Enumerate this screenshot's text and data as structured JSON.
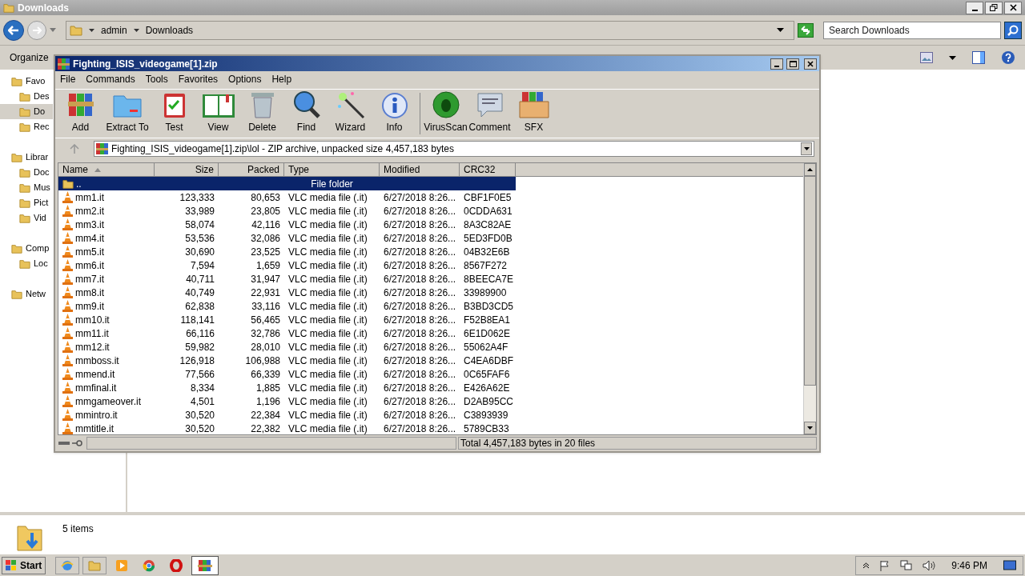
{
  "explorer": {
    "title": "Downloads",
    "breadcrumb": [
      "admin",
      "Downloads"
    ],
    "search": {
      "placeholder": "Search Downloads"
    },
    "toolbar": {
      "organize": "Organize"
    },
    "nav": [
      {
        "label": "Favo",
        "selected": false,
        "children": [
          {
            "label": "Des",
            "selected": false
          },
          {
            "label": "Do",
            "selected": true
          },
          {
            "label": "Rec",
            "selected": false
          }
        ]
      },
      {
        "label": "Librar",
        "selected": false,
        "children": [
          {
            "label": "Doc",
            "selected": false
          },
          {
            "label": "Mus",
            "selected": false
          },
          {
            "label": "Pict",
            "selected": false
          },
          {
            "label": "Vid",
            "selected": false
          }
        ]
      },
      {
        "label": "Comp",
        "selected": false,
        "children": [
          {
            "label": "Loc",
            "selected": false
          }
        ]
      },
      {
        "label": "Netw",
        "selected": false
      }
    ],
    "details": "5 items"
  },
  "winrar": {
    "title": "Fighting_ISIS_videogame[1].zip",
    "menu": [
      "File",
      "Commands",
      "Tools",
      "Favorites",
      "Options",
      "Help"
    ],
    "tools": [
      {
        "label": "Add"
      },
      {
        "label": "Extract To"
      },
      {
        "label": "Test"
      },
      {
        "label": "View"
      },
      {
        "label": "Delete"
      },
      {
        "label": "Find"
      },
      {
        "label": "Wizard"
      },
      {
        "label": "Info"
      },
      {
        "label": "VirusScan"
      },
      {
        "label": "Comment"
      },
      {
        "label": "SFX"
      }
    ],
    "address": "Fighting_ISIS_videogame[1].zip\\lol - ZIP archive, unpacked size 4,457,183 bytes",
    "columns": [
      {
        "label": "Name",
        "sorted": true
      },
      {
        "label": "Size",
        "sorted": false
      },
      {
        "label": "Packed",
        "sorted": false
      },
      {
        "label": "Type",
        "sorted": false
      },
      {
        "label": "Modified",
        "sorted": false
      },
      {
        "label": "CRC32",
        "sorted": false
      }
    ],
    "rows": [
      {
        "kind": "folder",
        "selected": true,
        "name": "..",
        "size": "",
        "packed": "",
        "type": "File folder",
        "modified": "",
        "crc": ""
      },
      {
        "kind": "file",
        "selected": false,
        "name": "mm1.it",
        "size": "123,333",
        "packed": "80,653",
        "type": "VLC media file (.it)",
        "modified": "6/27/2018 8:26...",
        "crc": "CBF1F0E5"
      },
      {
        "kind": "file",
        "selected": false,
        "name": "mm2.it",
        "size": "33,989",
        "packed": "23,805",
        "type": "VLC media file (.it)",
        "modified": "6/27/2018 8:26...",
        "crc": "0CDDA631"
      },
      {
        "kind": "file",
        "selected": false,
        "name": "mm3.it",
        "size": "58,074",
        "packed": "42,116",
        "type": "VLC media file (.it)",
        "modified": "6/27/2018 8:26...",
        "crc": "8A3C82AE"
      },
      {
        "kind": "file",
        "selected": false,
        "name": "mm4.it",
        "size": "53,536",
        "packed": "32,086",
        "type": "VLC media file (.it)",
        "modified": "6/27/2018 8:26...",
        "crc": "5ED3FD0B"
      },
      {
        "kind": "file",
        "selected": false,
        "name": "mm5.it",
        "size": "30,690",
        "packed": "23,525",
        "type": "VLC media file (.it)",
        "modified": "6/27/2018 8:26...",
        "crc": "04B32E6B"
      },
      {
        "kind": "file",
        "selected": false,
        "name": "mm6.it",
        "size": "7,594",
        "packed": "1,659",
        "type": "VLC media file (.it)",
        "modified": "6/27/2018 8:26...",
        "crc": "8567F272"
      },
      {
        "kind": "file",
        "selected": false,
        "name": "mm7.it",
        "size": "40,711",
        "packed": "31,947",
        "type": "VLC media file (.it)",
        "modified": "6/27/2018 8:26...",
        "crc": "8BEECA7E"
      },
      {
        "kind": "file",
        "selected": false,
        "name": "mm8.it",
        "size": "40,749",
        "packed": "22,931",
        "type": "VLC media file (.it)",
        "modified": "6/27/2018 8:26...",
        "crc": "33989900"
      },
      {
        "kind": "file",
        "selected": false,
        "name": "mm9.it",
        "size": "62,838",
        "packed": "33,116",
        "type": "VLC media file (.it)",
        "modified": "6/27/2018 8:26...",
        "crc": "B3BD3CD5"
      },
      {
        "kind": "file",
        "selected": false,
        "name": "mm10.it",
        "size": "118,141",
        "packed": "56,465",
        "type": "VLC media file (.it)",
        "modified": "6/27/2018 8:26...",
        "crc": "F52B8EA1"
      },
      {
        "kind": "file",
        "selected": false,
        "name": "mm11.it",
        "size": "66,116",
        "packed": "32,786",
        "type": "VLC media file (.it)",
        "modified": "6/27/2018 8:26...",
        "crc": "6E1D062E"
      },
      {
        "kind": "file",
        "selected": false,
        "name": "mm12.it",
        "size": "59,982",
        "packed": "28,010",
        "type": "VLC media file (.it)",
        "modified": "6/27/2018 8:26...",
        "crc": "55062A4F"
      },
      {
        "kind": "file",
        "selected": false,
        "name": "mmboss.it",
        "size": "126,918",
        "packed": "106,988",
        "type": "VLC media file (.it)",
        "modified": "6/27/2018 8:26...",
        "crc": "C4EA6DBF"
      },
      {
        "kind": "file",
        "selected": false,
        "name": "mmend.it",
        "size": "77,566",
        "packed": "66,339",
        "type": "VLC media file (.it)",
        "modified": "6/27/2018 8:26...",
        "crc": "0C65FAF6"
      },
      {
        "kind": "file",
        "selected": false,
        "name": "mmfinal.it",
        "size": "8,334",
        "packed": "1,885",
        "type": "VLC media file (.it)",
        "modified": "6/27/2018 8:26...",
        "crc": "E426A62E"
      },
      {
        "kind": "file",
        "selected": false,
        "name": "mmgameover.it",
        "size": "4,501",
        "packed": "1,196",
        "type": "VLC media file (.it)",
        "modified": "6/27/2018 8:26...",
        "crc": "D2AB95CC"
      },
      {
        "kind": "file",
        "selected": false,
        "name": "mmintro.it",
        "size": "30,520",
        "packed": "22,384",
        "type": "VLC media file (.it)",
        "modified": "6/27/2018 8:26...",
        "crc": "C3893939"
      },
      {
        "kind": "file",
        "selected": false,
        "name": "mmtitle.it",
        "size": "30,520",
        "packed": "22,382",
        "type": "VLC media file (.it)",
        "modified": "6/27/2018 8:26...",
        "crc": "5789CB33"
      }
    ],
    "status": "Total 4,457,183 bytes in 20 files"
  },
  "taskbar": {
    "start": "Start",
    "time": "9:46 PM"
  }
}
